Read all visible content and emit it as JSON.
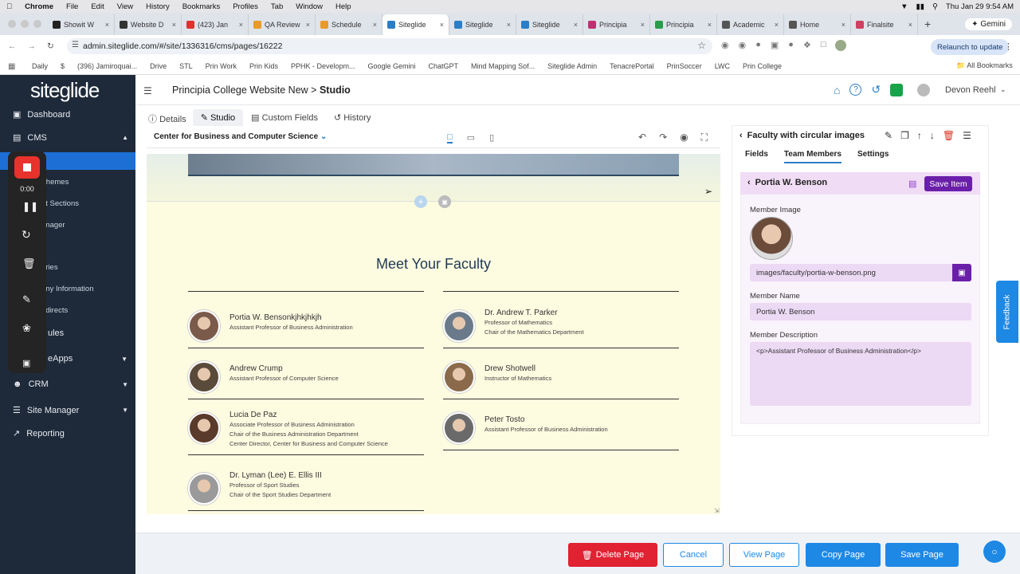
{
  "macbar": {
    "app": "Chrome",
    "menus": [
      "File",
      "Edit",
      "View",
      "History",
      "Bookmarks",
      "Profiles",
      "Tab",
      "Window",
      "Help"
    ],
    "clock": "Thu Jan 29  9:54 AM"
  },
  "tabs": [
    {
      "label": "Showit W",
      "color": "#222"
    },
    {
      "label": "Website D",
      "color": "#333"
    },
    {
      "label": "(423) Jan",
      "color": "#e03030"
    },
    {
      "label": "QA Review",
      "color": "#e89b2a"
    },
    {
      "label": "Schedule",
      "color": "#e89b2a"
    },
    {
      "label": "Siteglide",
      "color": "#2a7ec7",
      "active": true
    },
    {
      "label": "Siteglide",
      "color": "#2a7ec7"
    },
    {
      "label": "Siteglide",
      "color": "#2a7ec7"
    },
    {
      "label": "Principia",
      "color": "#c03070"
    },
    {
      "label": "Principia",
      "color": "#2a9d4a"
    },
    {
      "label": "Academic",
      "color": "#555"
    },
    {
      "label": "Home",
      "color": "#555"
    },
    {
      "label": "Finalsite",
      "color": "#d04060"
    }
  ],
  "gemini_label": "Gemini",
  "url": "admin.siteglide.com/#/site/1336316/cms/pages/16222",
  "relaunch": "Relaunch to update",
  "bookmarks": [
    "Daily",
    "$",
    "(396) Jamiroquai...",
    "Drive",
    "STL",
    "Prin Work",
    "Prin Kids",
    "PPHK - Developm...",
    "Google Gemini",
    "ChatGPT",
    "Mind Mapping Sof...",
    "Siteglide Admin",
    "TenacrePortal",
    "PrinSoccer",
    "LWC",
    "Prin College"
  ],
  "all_bookmarks": "All Bookmarks",
  "sidebar": {
    "logo": "siteglide",
    "dashboard": "Dashboard",
    "cms": "CMS",
    "subs": [
      "Themes",
      "nt Sections",
      "anager",
      "ories",
      "any Information",
      "edirects"
    ],
    "modules": "ules",
    "webapps": "eApps",
    "crm": "CRM",
    "site_manager": "Site Manager",
    "reporting": "Reporting"
  },
  "recorder": {
    "time": "0:00"
  },
  "header": {
    "breadcrumb": "Principia College Website New > ",
    "page": "Studio",
    "user": "Devon Reehl"
  },
  "page_tabs": [
    "Details",
    "Studio",
    "Custom Fields",
    "History"
  ],
  "section_select": "Center for Business and Computer Science",
  "canvas": {
    "heading": "Meet Your Faculty",
    "faculty": [
      {
        "name": "Portia W. Bensonkjhkjhkjh",
        "lines": [
          "Assistant Professor of Business Administration"
        ]
      },
      {
        "name": "Dr. Andrew T. Parker",
        "lines": [
          "Professor of Mathematics",
          "Chair of the Mathematics Department"
        ]
      },
      {
        "name": "Andrew Crump",
        "lines": [
          "Assistant Professor of Computer Science"
        ]
      },
      {
        "name": "Drew Shotwell",
        "lines": [
          "Instructor of Mathematics"
        ]
      },
      {
        "name": "Lucia De Paz",
        "lines": [
          "Associate Professor of Business Administration",
          "Chair of the Business Administration Department",
          "Center Director, Center for Business and Computer Science"
        ]
      },
      {
        "name": "Peter Tosto",
        "lines": [
          "Assistant Professor of Business Administration"
        ]
      },
      {
        "name": "Dr. Lyman (Lee) E. Ellis III",
        "lines": [
          "Professor of Sport Studies",
          "Chair of the Sport Studies Department"
        ]
      }
    ]
  },
  "panel": {
    "title": "Faculty with circular images",
    "tabs": [
      "Fields",
      "Team Members",
      "Settings"
    ],
    "item_name": "Portia W. Benson",
    "save_item": "Save Item",
    "image_label": "Member Image",
    "image_path": "images/faculty/portia-w-benson.png",
    "name_label": "Member Name",
    "name_value": "Portia W. Benson",
    "desc_label": "Member Description",
    "desc_value": "<p>Assistant Professor of Business Administration</p>"
  },
  "feedback": "Feedback",
  "footer": {
    "delete": "Delete Page",
    "cancel": "Cancel",
    "view": "View Page",
    "copy": "Copy Page",
    "save": "Save Page"
  }
}
